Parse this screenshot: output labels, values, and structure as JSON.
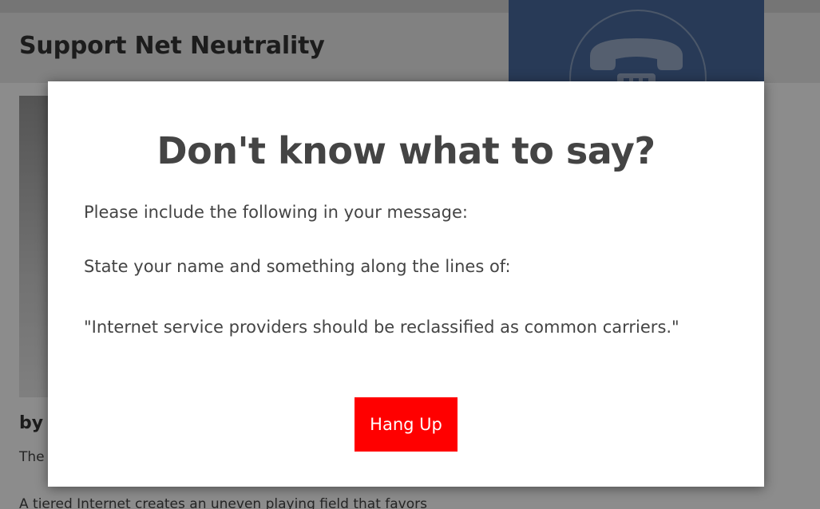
{
  "page": {
    "title": "Support Net Neutrality",
    "byline": "by",
    "snippet": "The",
    "paragraph": "A tiered Internet creates an uneven playing field that favors"
  },
  "call_panel": {
    "icon": "telephone-icon",
    "color": "#4a6b9e"
  },
  "modal": {
    "title": "Don't know what to say?",
    "line1": "Please include the following in your message:",
    "line2": "State your name and something along the lines of:",
    "quote": "\"Internet service providers should be reclassified as common carriers.\"",
    "button_label": "Hang Up",
    "button_color": "#ff0000"
  }
}
